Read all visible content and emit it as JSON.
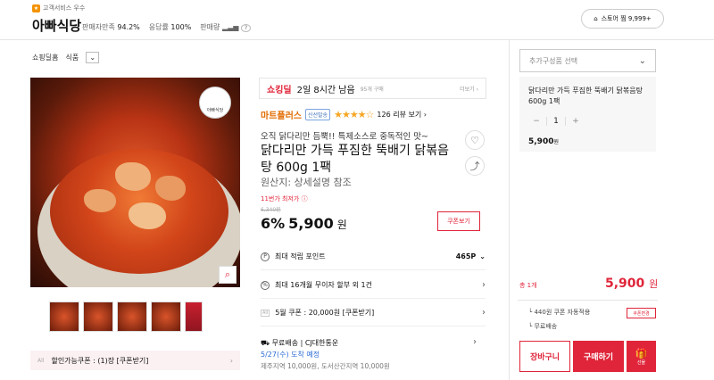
{
  "header": {
    "seller_badge": "고객서비스 우수",
    "store_name": "아빠식당",
    "stats": [
      {
        "label": "판매자만족",
        "value": "94.2%"
      },
      {
        "label": "응답률",
        "value": "100%"
      },
      {
        "label": "판매량",
        "value": ""
      }
    ],
    "store_button": "스토어 찜 9,999+"
  },
  "breadcrumb": {
    "home": "쇼핑딜홈",
    "category": "식품"
  },
  "gallery": {
    "logo_text": "아빠식당",
    "thumbnails": [
      "dish-1",
      "dish-2",
      "dish-3",
      "dish-4",
      "promo"
    ],
    "coupon_tag": "All",
    "coupon_text": "할인가능쿠폰 : (1)장 [쿠폰받기]"
  },
  "shocking_deal": {
    "brand": "쇼킹딜",
    "remaining": "2일 8시간 남음",
    "buyers": "95개 구매",
    "more": "더보기"
  },
  "product": {
    "brand": "마트플러스",
    "badge": "신선발송",
    "rating": 4,
    "reviews": "126 리뷰 보기",
    "subtitle": "오직 닭다리만 듬뿍!! 특제소스로 중독적인 맛~",
    "title": "닭다리만 가득 푸짐한 뚝배기 닭볶음탕 600g 1팩",
    "origin": "원산지: 상세설명 참조",
    "cheapest": "11번가 최저가",
    "original_price": "6,340원",
    "discount": "6%",
    "price": "5,900",
    "price_unit": "원",
    "coupon_button": "쿠폰보기"
  },
  "info_rows": {
    "points_label": "최대 적립 포인트",
    "points_value": "465P",
    "installment": "최대 16개월 무이자 할부 외 1건",
    "coupon_tag": "All",
    "coupon": "5월 쿠폰 : 20,000원 [쿠폰받기]"
  },
  "shipping": {
    "line1": "무료배송 | CJ대한통운",
    "line2": "5/27(수) 도착 예정",
    "line3": "제주지역 10,000원, 도서산간지역 10,000원"
  },
  "order": {
    "select_placeholder": "추가구성품 선택",
    "option_name": "닭다리만 가득 푸짐한 뚝배기 닭볶음탕 600g 1팩",
    "qty": "1",
    "option_price": "5,900",
    "option_unit": "원",
    "total_label": "총 1개",
    "total": "5,900",
    "total_unit": "원",
    "coupon_applied": "440원 쿠폰 자동적용",
    "coupon_change": "쿠폰변경",
    "free_shipping": "무료배송",
    "cart": "장바구니",
    "buy": "구매하기",
    "gift": "선물"
  }
}
